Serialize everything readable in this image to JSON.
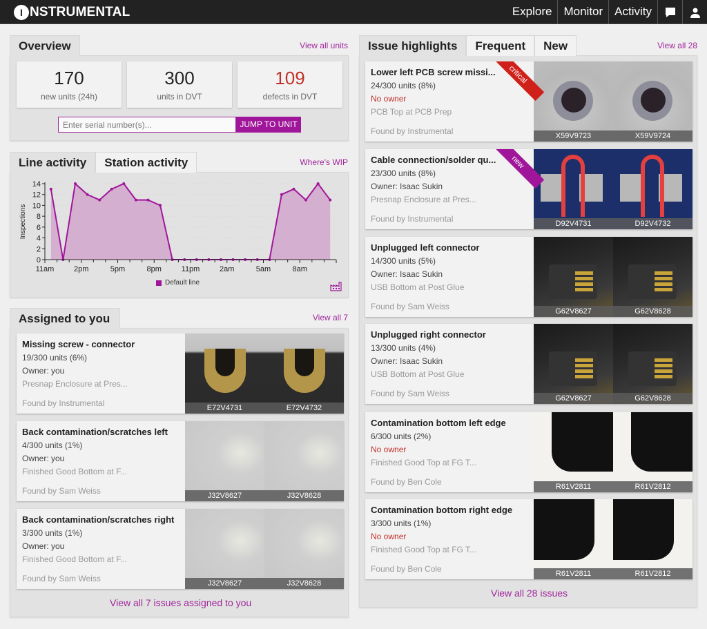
{
  "app": {
    "logo": "NSTRUMENTAL",
    "logo_initial": "I",
    "nav": [
      {
        "label": "Explore"
      },
      {
        "label": "Monitor"
      },
      {
        "label": "Activity"
      }
    ],
    "icons": [
      "chat-icon",
      "user-icon"
    ]
  },
  "overview": {
    "tab": "Overview",
    "link": "View all units",
    "stats": [
      {
        "value": "170",
        "label": "new units (24h)"
      },
      {
        "value": "300",
        "label": "units in DVT"
      },
      {
        "value": "109",
        "label": "defects in DVT",
        "color": "#c0302a"
      }
    ],
    "serial_placeholder": "Enter serial number(s)...",
    "jump_button": "JUMP TO UNIT"
  },
  "activity": {
    "tabs": [
      "Line activity",
      "Station activity"
    ],
    "link": "Where's WIP",
    "legend": "Default line"
  },
  "chart_data": {
    "type": "area",
    "title": "",
    "xlabel": "",
    "ylabel": "Inspections",
    "ylim": [
      0,
      14
    ],
    "yticks": [
      0,
      2,
      4,
      6,
      8,
      10,
      12,
      14
    ],
    "xtick_labels": [
      "11am",
      "2pm",
      "5pm",
      "8pm",
      "11pm",
      "2am",
      "5am",
      "8am"
    ],
    "x_hours_from_11am": [
      0.5,
      1.5,
      2.5,
      3.5,
      4.5,
      5.5,
      6.5,
      7.5,
      8.5,
      9.5,
      10.5,
      11.5,
      12.5,
      13.5,
      14.5,
      15.5,
      16.5,
      17.5,
      18.5,
      19.5,
      20.5,
      21.5,
      22.5,
      23.5
    ],
    "series": [
      {
        "name": "Default line",
        "color": "#a0169a",
        "values": [
          13,
          0,
          14,
          12,
          11,
          13,
          14,
          11,
          11,
          10,
          0,
          0,
          0,
          0,
          0,
          0,
          0,
          0,
          0,
          12,
          13,
          11,
          14,
          11
        ]
      }
    ],
    "legend": "bottom-center",
    "grid": true
  },
  "assigned": {
    "tab": "Assigned to you",
    "link": "View all 7",
    "footer": "View all 7 issues assigned to you",
    "items": [
      {
        "title": "Missing screw - connector",
        "units": "19/300 units (6%)",
        "owner": "Owner: you",
        "station": "Presnap Enclosure at Pres...",
        "found": "Found by Instrumental",
        "thumbs": [
          "E72V4731",
          "E72V4732"
        ]
      },
      {
        "title": "Back contamination/scratches left",
        "units": "4/300 units (1%)",
        "owner": "Owner: you",
        "station": "Finished Good Bottom at F...",
        "found": "Found by Sam Weiss",
        "thumbs": [
          "J32V8627",
          "J32V8628"
        ]
      },
      {
        "title": "Back contamination/scratches right",
        "units": "3/300 units (1%)",
        "owner": "Owner: you",
        "station": "Finished Good Bottom at F...",
        "found": "Found by Sam Weiss",
        "thumbs": [
          "J32V8627",
          "J32V8628"
        ]
      }
    ]
  },
  "issues": {
    "tabs": [
      "Issue highlights",
      "Frequent",
      "New"
    ],
    "link": "View all 28",
    "footer": "View all 28 issues",
    "items": [
      {
        "title": "Lower left PCB screw missi...",
        "units": "24/300 units (8%)",
        "owner": "No owner",
        "station": "PCB Top at PCB Prep",
        "found": "Found by Instrumental",
        "badge": "critical",
        "badge_color": "#d0201a",
        "thumbs": [
          "X59V9723",
          "X59V9724"
        ]
      },
      {
        "title": "Cable connection/solder qu...",
        "units": "23/300 units (8%)",
        "owner": "Owner: Isaac Sukin",
        "station": "Presnap Enclosure at Pres...",
        "found": "Found by Instrumental",
        "badge": "new",
        "badge_color": "#a0169a",
        "thumbs": [
          "D92V4731",
          "D92V4732"
        ]
      },
      {
        "title": "Unplugged left connector",
        "units": "14/300 units (5%)",
        "owner": "Owner: Isaac Sukin",
        "station": "USB Bottom at Post Glue",
        "found": "Found by Sam Weiss",
        "thumbs": [
          "G62V8627",
          "G62V8628"
        ]
      },
      {
        "title": "Unplugged right connector",
        "units": "13/300 units (4%)",
        "owner": "Owner: Isaac Sukin",
        "station": "USB Bottom at Post Glue",
        "found": "Found by Sam Weiss",
        "thumbs": [
          "G62V8627",
          "G62V8628"
        ]
      },
      {
        "title": "Contamination bottom left edge",
        "units": "6/300 units (2%)",
        "owner": "No owner",
        "station": "Finished Good Top at FG T...",
        "found": "Found by Ben Cole",
        "thumbs": [
          "R61V2811",
          "R61V2812"
        ]
      },
      {
        "title": "Contamination bottom right edge",
        "units": "3/300 units (1%)",
        "owner": "No owner",
        "station": "Finished Good Top at FG T...",
        "found": "Found by Ben Cole",
        "thumbs": [
          "R61V2811",
          "R61V2812"
        ]
      }
    ]
  }
}
